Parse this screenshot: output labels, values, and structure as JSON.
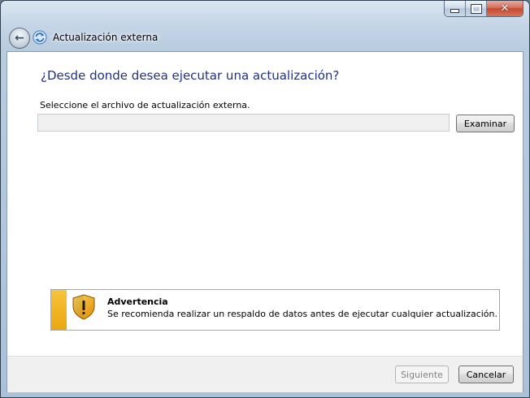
{
  "window": {
    "title": "Actualización externa",
    "controls": [
      "minimize-icon",
      "maximize-icon",
      "close-icon"
    ]
  },
  "content": {
    "heading": "¿Desde donde desea ejecutar una actualización?",
    "instruction": "Seleccione el archivo de actualización externa.",
    "path_value": "",
    "browse_label": "Examinar"
  },
  "warning": {
    "icon": "warning-shield-icon",
    "title": "Advertencia",
    "message": "Se recomienda realizar un respaldo de datos antes de ejecutar cualquier actualización."
  },
  "footer": {
    "next_label": "Siguiente",
    "cancel_label": "Cancelar"
  }
}
